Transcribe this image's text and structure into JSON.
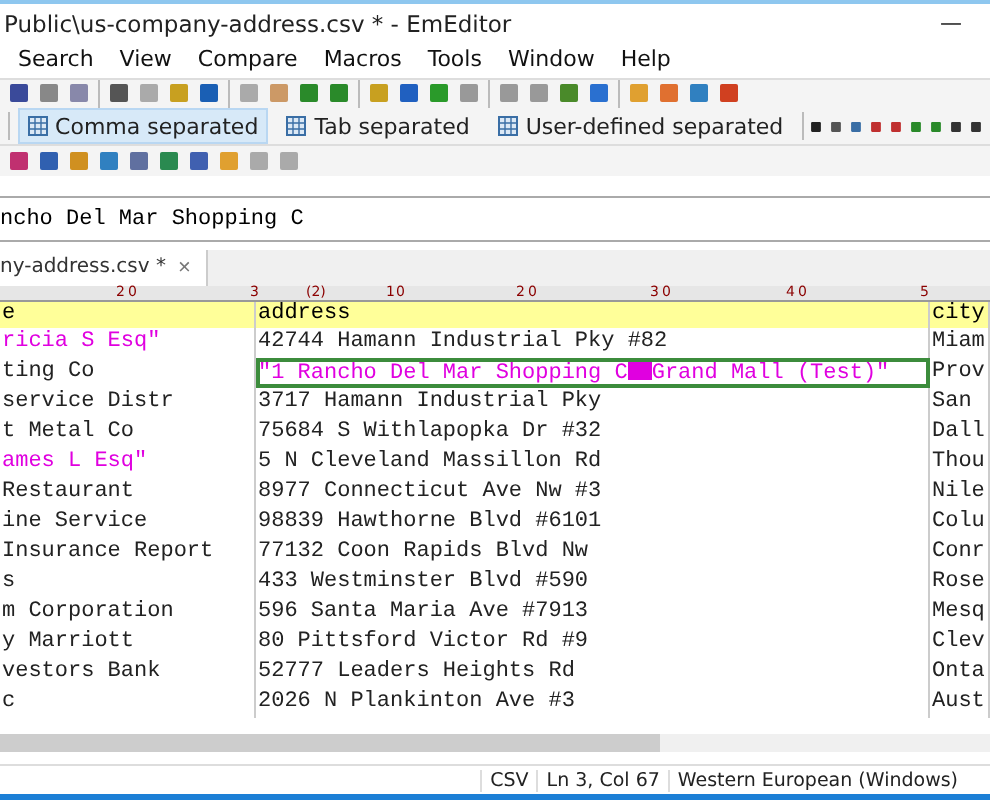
{
  "window": {
    "title": "Public\\us-company-address.csv * - EmEditor",
    "minimize": "—"
  },
  "menu": [
    "Search",
    "View",
    "Compare",
    "Macros",
    "Tools",
    "Window",
    "Help"
  ],
  "csv_modes": [
    {
      "label": "Comma separated",
      "selected": true
    },
    {
      "label": "Tab separated",
      "selected": false
    },
    {
      "label": "User-defined separated",
      "selected": false
    }
  ],
  "cell_editor": {
    "value": "ncho Del Mar Shopping C"
  },
  "tab": {
    "label": "ny-address.csv *",
    "close": "×"
  },
  "ruler": [
    "2",
    "0",
    "3",
    "(2)",
    "1",
    "0",
    "2",
    "0",
    "3",
    "0",
    "4",
    "0",
    "5"
  ],
  "table": {
    "columns": [
      "e",
      "address",
      "city"
    ],
    "rows": [
      {
        "cells": [
          {
            "text": "ricia S Esq\"",
            "quoted": true,
            "selected": false
          },
          {
            "text": "42744 Hamann Industrial Pky #82",
            "quoted": false,
            "selected": false
          },
          {
            "text": "Miam",
            "quoted": false,
            "selected": false
          }
        ]
      },
      {
        "cells": [
          {
            "text": "ting Co",
            "quoted": false,
            "selected": false
          },
          {
            "text": "\"1 Rancho Del Mar Shopping C",
            "tail": "Grand Mall (Test)\"",
            "quoted": true,
            "selected": true
          },
          {
            "text": "Prov",
            "quoted": false,
            "selected": false
          }
        ]
      },
      {
        "cells": [
          {
            "text": "service Distr",
            "quoted": false,
            "selected": false
          },
          {
            "text": "3717 Hamann Industrial Pky",
            "quoted": false,
            "selected": false
          },
          {
            "text": "San",
            "quoted": false,
            "selected": false
          }
        ]
      },
      {
        "cells": [
          {
            "text": "t Metal Co",
            "quoted": false,
            "selected": false
          },
          {
            "text": "75684 S Withlapopka Dr #32",
            "quoted": false,
            "selected": false
          },
          {
            "text": "Dall",
            "quoted": false,
            "selected": false
          }
        ]
      },
      {
        "cells": [
          {
            "text": "ames L Esq\"",
            "quoted": true,
            "selected": false
          },
          {
            "text": "5 N Cleveland Massillon Rd",
            "quoted": false,
            "selected": false
          },
          {
            "text": "Thou",
            "quoted": false,
            "selected": false
          }
        ]
      },
      {
        "cells": [
          {
            "text": "Restaurant",
            "quoted": false,
            "selected": false
          },
          {
            "text": "8977 Connecticut Ave Nw #3",
            "quoted": false,
            "selected": false
          },
          {
            "text": "Nile",
            "quoted": false,
            "selected": false
          }
        ]
      },
      {
        "cells": [
          {
            "text": "ine Service",
            "quoted": false,
            "selected": false
          },
          {
            "text": "98839 Hawthorne Blvd #6101",
            "quoted": false,
            "selected": false
          },
          {
            "text": "Colu",
            "quoted": false,
            "selected": false
          }
        ]
      },
      {
        "cells": [
          {
            "text": "Insurance Report",
            "quoted": false,
            "selected": false
          },
          {
            "text": "77132 Coon Rapids Blvd Nw",
            "quoted": false,
            "selected": false
          },
          {
            "text": "Conr",
            "quoted": false,
            "selected": false
          }
        ]
      },
      {
        "cells": [
          {
            "text": "s",
            "quoted": false,
            "selected": false
          },
          {
            "text": "433 Westminster Blvd #590",
            "quoted": false,
            "selected": false
          },
          {
            "text": "Rose",
            "quoted": false,
            "selected": false
          }
        ]
      },
      {
        "cells": [
          {
            "text": "m Corporation",
            "quoted": false,
            "selected": false
          },
          {
            "text": "596 Santa Maria Ave #7913",
            "quoted": false,
            "selected": false
          },
          {
            "text": "Mesq",
            "quoted": false,
            "selected": false
          }
        ]
      },
      {
        "cells": [
          {
            "text": "y Marriott",
            "quoted": false,
            "selected": false
          },
          {
            "text": "80 Pittsford Victor Rd #9",
            "quoted": false,
            "selected": false
          },
          {
            "text": "Clev",
            "quoted": false,
            "selected": false
          }
        ]
      },
      {
        "cells": [
          {
            "text": "vestors Bank",
            "quoted": false,
            "selected": false
          },
          {
            "text": "52777 Leaders Heights Rd",
            "quoted": false,
            "selected": false
          },
          {
            "text": "Onta",
            "quoted": false,
            "selected": false
          }
        ]
      },
      {
        "cells": [
          {
            "text": "c",
            "quoted": false,
            "selected": false
          },
          {
            "text": "2026 N Plankinton Ave #3",
            "quoted": false,
            "selected": false
          },
          {
            "text": "Aust",
            "quoted": false,
            "selected": false
          }
        ]
      }
    ]
  },
  "status_bar": [
    "CSV",
    "Ln 3, Col 67",
    "Western European (Windows)"
  ]
}
